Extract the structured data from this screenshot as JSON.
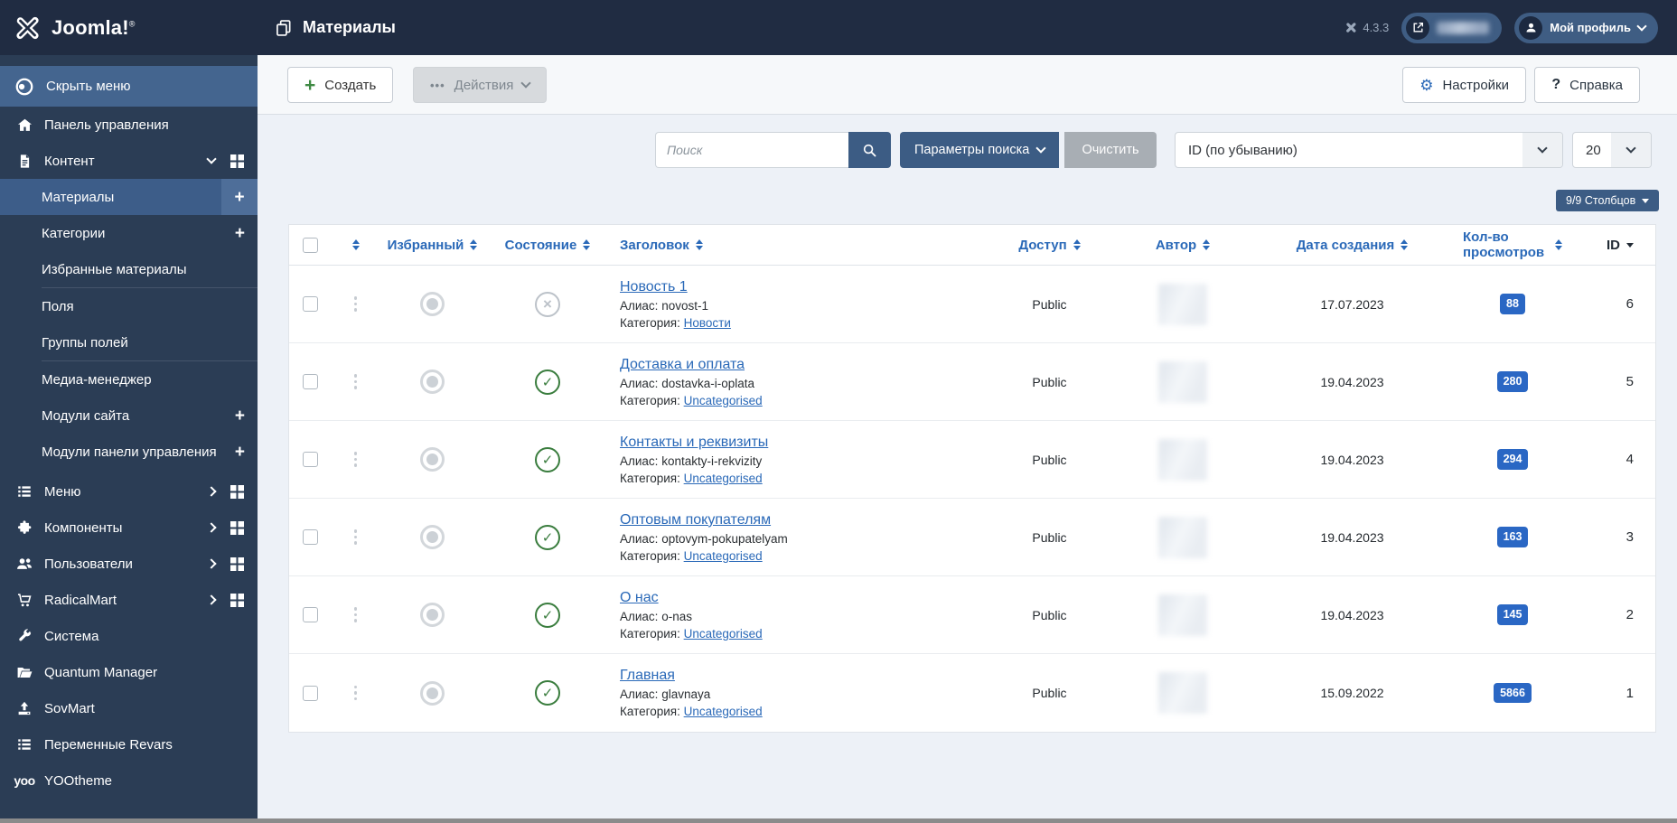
{
  "header": {
    "title": "Материалы",
    "version": "4.3.3",
    "profile_label": "Мой профиль"
  },
  "sidebar": {
    "logo_text": "Joomla!",
    "reg_mark": "®",
    "toggle_label": "Скрыть меню",
    "dashboard_label": "Панель управления",
    "content_label": "Контент",
    "content_submenu": [
      {
        "label": "Материалы",
        "active": true,
        "plus": true
      },
      {
        "label": "Категории",
        "plus": true
      },
      {
        "label": "Избранные материалы",
        "divider_after": true
      },
      {
        "label": "Поля"
      },
      {
        "label": "Группы полей",
        "divider_after": true
      },
      {
        "label": "Медиа-менеджер"
      },
      {
        "label": "Модули сайта",
        "plus": true
      },
      {
        "label": "Модули панели управления",
        "plus": true
      }
    ],
    "items": [
      {
        "label": "Меню",
        "icon": "list",
        "chevron": true,
        "grid": true
      },
      {
        "label": "Компоненты",
        "icon": "puzzle",
        "chevron": true,
        "grid": true
      },
      {
        "label": "Пользователи",
        "icon": "users",
        "chevron": true,
        "grid": true
      },
      {
        "label": "RadicalMart",
        "icon": "cart",
        "chevron": true,
        "grid": true
      },
      {
        "label": "Система",
        "icon": "wrench"
      },
      {
        "label": "Quantum Manager",
        "icon": "folder"
      },
      {
        "label": "SovMart",
        "icon": "upload"
      },
      {
        "label": "Переменные Revars",
        "icon": "list"
      },
      {
        "label": "YOOtheme",
        "icon": "yoo"
      }
    ]
  },
  "toolbar": {
    "new_label": "Создать",
    "actions_label": "Действия",
    "options_label": "Настройки",
    "help_label": "Справка"
  },
  "filters": {
    "search_placeholder": "Поиск",
    "search_tools_label": "Параметры поиска",
    "clear_label": "Очистить",
    "sort_value": "ID (по убыванию)",
    "page_size": "20",
    "columns_label": "9/9 Столбцов"
  },
  "table": {
    "headers": {
      "featured": "Избранный",
      "state": "Состояние",
      "title": "Заголовок",
      "access": "Доступ",
      "author": "Автор",
      "created": "Дата создания",
      "hits": "Кол-во просмотров",
      "id": "ID"
    },
    "alias_label": "Алиас:",
    "category_label": "Категория:",
    "rows": [
      {
        "title": "Новость 1",
        "alias": "novost-1",
        "category": "Новости",
        "access": "Public",
        "date": "17.07.2023",
        "hits": "88",
        "id": "6",
        "state": "unpublished"
      },
      {
        "title": "Доставка и оплата",
        "alias": "dostavka-i-oplata",
        "category": "Uncategorised",
        "access": "Public",
        "date": "19.04.2023",
        "hits": "280",
        "id": "5",
        "state": "published"
      },
      {
        "title": "Контакты и реквизиты",
        "alias": "kontakty-i-rekvizity",
        "category": "Uncategorised",
        "access": "Public",
        "date": "19.04.2023",
        "hits": "294",
        "id": "4",
        "state": "published"
      },
      {
        "title": "Оптовым покупателям",
        "alias": "optovym-pokupatelyam",
        "category": "Uncategorised",
        "access": "Public",
        "date": "19.04.2023",
        "hits": "163",
        "id": "3",
        "state": "published"
      },
      {
        "title": "О нас",
        "alias": "o-nas",
        "category": "Uncategorised",
        "access": "Public",
        "date": "19.04.2023",
        "hits": "145",
        "id": "2",
        "state": "published"
      },
      {
        "title": "Главная",
        "alias": "glavnaya",
        "category": "Uncategorised",
        "access": "Public",
        "date": "15.09.2022",
        "hits": "5866",
        "id": "1",
        "state": "published"
      }
    ]
  },
  "colors": {
    "accent_link": "#2a69b8",
    "steel_blue": "#3c5c84",
    "hits_badge": "#2a67c4",
    "published_green": "#3a7d3e",
    "header_bg": "#202c42",
    "sidebar_bg": "#2b3d55"
  }
}
